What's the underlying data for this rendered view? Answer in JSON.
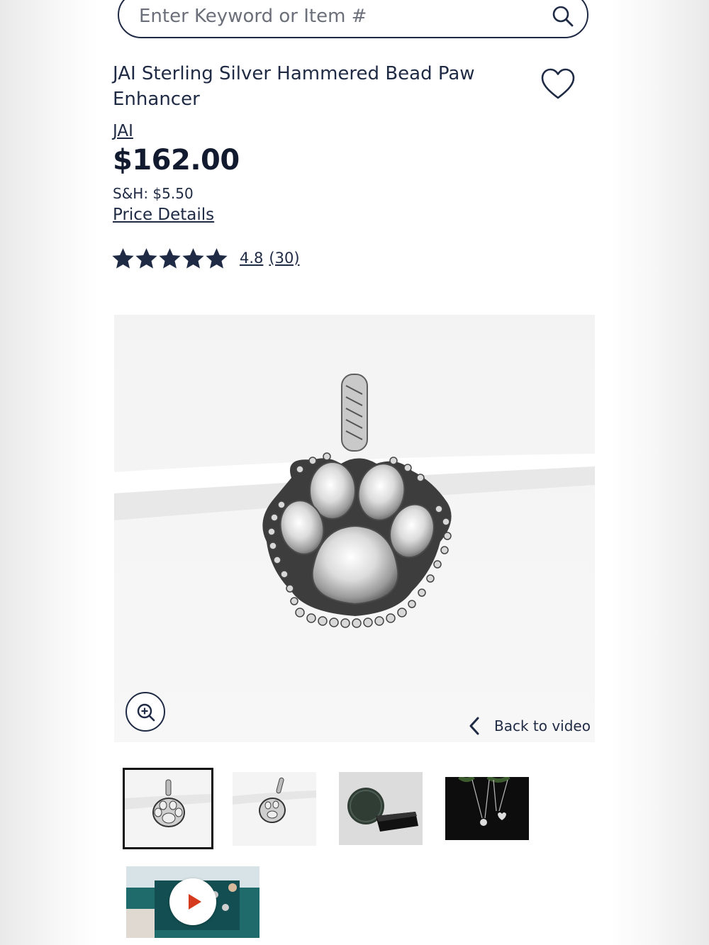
{
  "search": {
    "placeholder": "Enter Keyword or Item #"
  },
  "product": {
    "title": "JAI Sterling Silver Hammered Bead Paw Enhancer",
    "brand": "JAI",
    "price": "$162.00",
    "shipping": "S&H: $5.50",
    "price_details_label": "Price Details",
    "rating": {
      "stars": 5,
      "value": "4.8",
      "count": "(30)"
    }
  },
  "gallery": {
    "back_label": "Back to video",
    "thumbnails": [
      "paw-front",
      "paw-side",
      "gift-box",
      "model-necklace"
    ],
    "selected_index": 0
  },
  "colors": {
    "text": "#1f2a44",
    "play": "#d63a1e"
  },
  "icons": [
    "search-icon",
    "heart-icon",
    "star-icon",
    "zoom-in-icon",
    "chevron-left-icon",
    "play-icon"
  ]
}
